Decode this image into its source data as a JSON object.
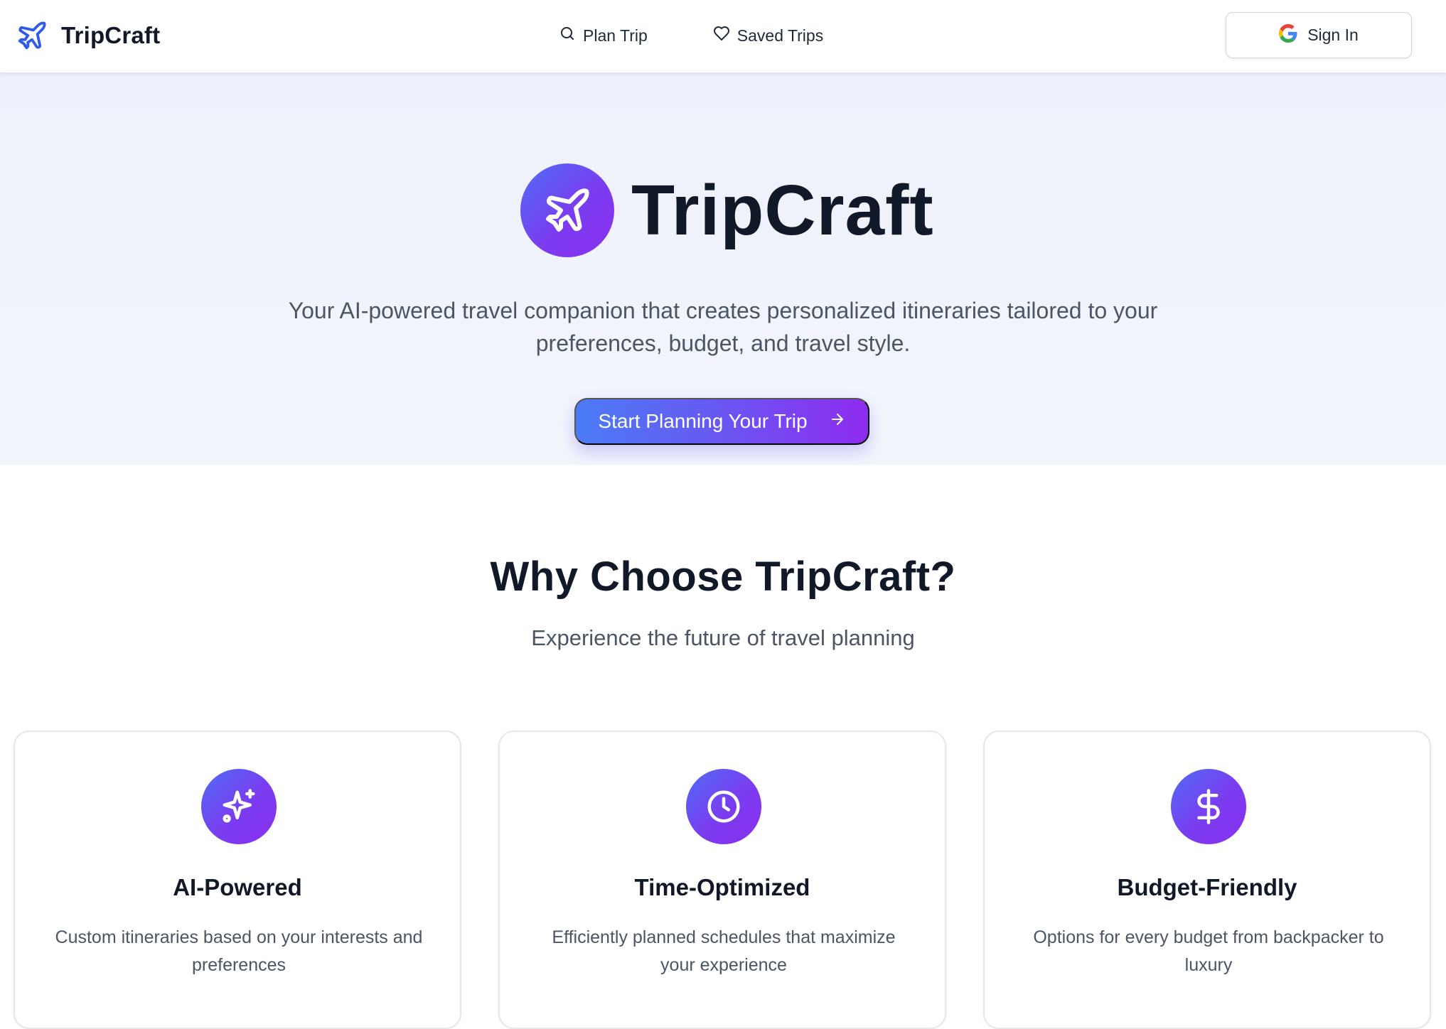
{
  "navbar": {
    "brand": "TripCraft",
    "links": [
      {
        "label": "Plan Trip",
        "icon": "search-icon"
      },
      {
        "label": "Saved Trips",
        "icon": "heart-icon"
      }
    ],
    "signin_label": "Sign In",
    "signin_icon": "google-icon"
  },
  "hero": {
    "title": "TripCraft",
    "subtitle_line1": "Your AI-powered travel companion that creates personalized itineraries tailored to your",
    "subtitle_line2": "preferences, budget, and travel style.",
    "cta_label": "Start Planning Your Trip",
    "cta_icon": "arrow-right-icon"
  },
  "features": {
    "title": "Why Choose TripCraft?",
    "subtitle": "Experience the future of travel planning",
    "cards": [
      {
        "title": "AI-Powered",
        "desc": "Custom itineraries based on your interests and preferences",
        "icon": "sparkles-icon"
      },
      {
        "title": "Time-Optimized",
        "desc": "Efficiently planned schedules that maximize your experience",
        "icon": "clock-icon"
      },
      {
        "title": "Budget-Friendly",
        "desc": "Options for every budget from backpacker to luxury",
        "icon": "dollar-icon"
      }
    ]
  },
  "colors": {
    "brand_blue": "#2f5be8",
    "gradient_start": "#4f6cf5",
    "gradient_end": "#8b2ff0",
    "hero_bg": "#eef1fb"
  }
}
